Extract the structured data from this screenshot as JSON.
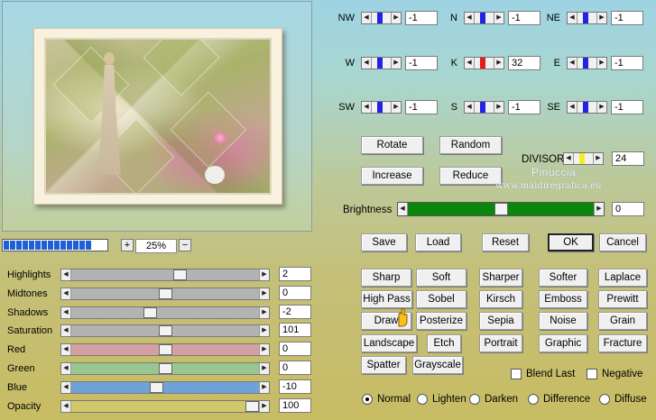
{
  "zoom": {
    "value": "25%",
    "plus": "+",
    "minus": "−"
  },
  "progress": {
    "blocks": 14
  },
  "adjust_sliders": [
    {
      "label": "Highlights",
      "value": "2",
      "color": "#b3b3b3",
      "fill": 0.585
    },
    {
      "label": "Midtones",
      "value": "0",
      "color": "#b3b3b3",
      "fill": 0.5
    },
    {
      "label": "Shadows",
      "value": "-2",
      "color": "#b3b3b3",
      "fill": 0.415
    },
    {
      "label": "Saturation",
      "value": "101",
      "color": "#b3b3b3",
      "fill": 0.5
    },
    {
      "label": "Red",
      "value": "0",
      "color": "#d4a0a2",
      "fill": 0.5
    },
    {
      "label": "Green",
      "value": "0",
      "color": "#98c691",
      "fill": 0.5
    },
    {
      "label": "Blue",
      "value": "-10",
      "color": "#6ea2d8",
      "fill": 0.45
    },
    {
      "label": "Opacity",
      "value": "100",
      "color": "#cfc96a",
      "fill": 1.0
    }
  ],
  "direction_grid": [
    {
      "label": "NW",
      "value": "-1"
    },
    {
      "label": "N",
      "value": "-1"
    },
    {
      "label": "NE",
      "value": "-1"
    },
    {
      "label": "W",
      "value": "-1"
    },
    {
      "label": "K",
      "value": "32"
    },
    {
      "label": "E",
      "value": "-1"
    },
    {
      "label": "SW",
      "value": "-1"
    },
    {
      "label": "S",
      "value": "-1"
    },
    {
      "label": "SE",
      "value": "-1"
    }
  ],
  "colors": {
    "marker_blue": "#2323e6",
    "marker_red": "#e01e1e",
    "marker_yellow": "#f2f020",
    "brightness_green": "#0a860a"
  },
  "matrix_buttons": {
    "rotate": "Rotate",
    "random": "Random",
    "increase": "Increase",
    "reduce": "Reduce"
  },
  "divisor": {
    "label": "DIVISOR",
    "value": "24"
  },
  "watermark": {
    "name": "Pinuccia",
    "url": "www.maidiregrafica.eu"
  },
  "brightness": {
    "label": "Brightness",
    "value": "0",
    "fill": 0.5
  },
  "actions": {
    "save": "Save",
    "load": "Load",
    "reset": "Reset",
    "ok": "OK",
    "cancel": "Cancel"
  },
  "presets": [
    [
      "Sharp",
      "Soft",
      "Sharper",
      "Softer",
      "Laplace"
    ],
    [
      "High Pass",
      "Sobel",
      "Kirsch",
      "Emboss",
      "Prewitt"
    ],
    [
      "Draw",
      "Posterize",
      "Sepia",
      "Noise",
      "Grain"
    ],
    [
      "Landscape",
      "Etch",
      "Portrait",
      "Graphic",
      "Fracture"
    ],
    [
      "Spatter",
      "Grayscale"
    ]
  ],
  "options": {
    "blend_last": "Blend Last",
    "negative": "Negative"
  },
  "blend_modes": [
    "Normal",
    "Lighten",
    "Darken",
    "Difference",
    "Diffuse"
  ],
  "selected_blend": "Normal"
}
